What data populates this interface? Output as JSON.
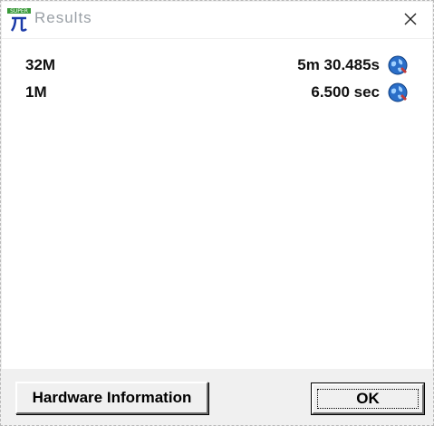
{
  "window": {
    "title": "Results"
  },
  "icons": {
    "app": "super-pi-icon",
    "close": "close-icon",
    "globe": "globe-icon"
  },
  "results": [
    {
      "size": "32M",
      "time": "5m 30.485s"
    },
    {
      "size": "1M",
      "time": "6.500 sec"
    }
  ],
  "buttons": {
    "hardware_label": "Hardware Information",
    "ok_label": "OK"
  },
  "colors": {
    "dialog_bg": "#f0f0f0",
    "content_bg": "#ffffff",
    "icon_green": "#3a9a3a",
    "icon_blue": "#1a3aa8",
    "globe_blue": "#2a6ec8"
  }
}
